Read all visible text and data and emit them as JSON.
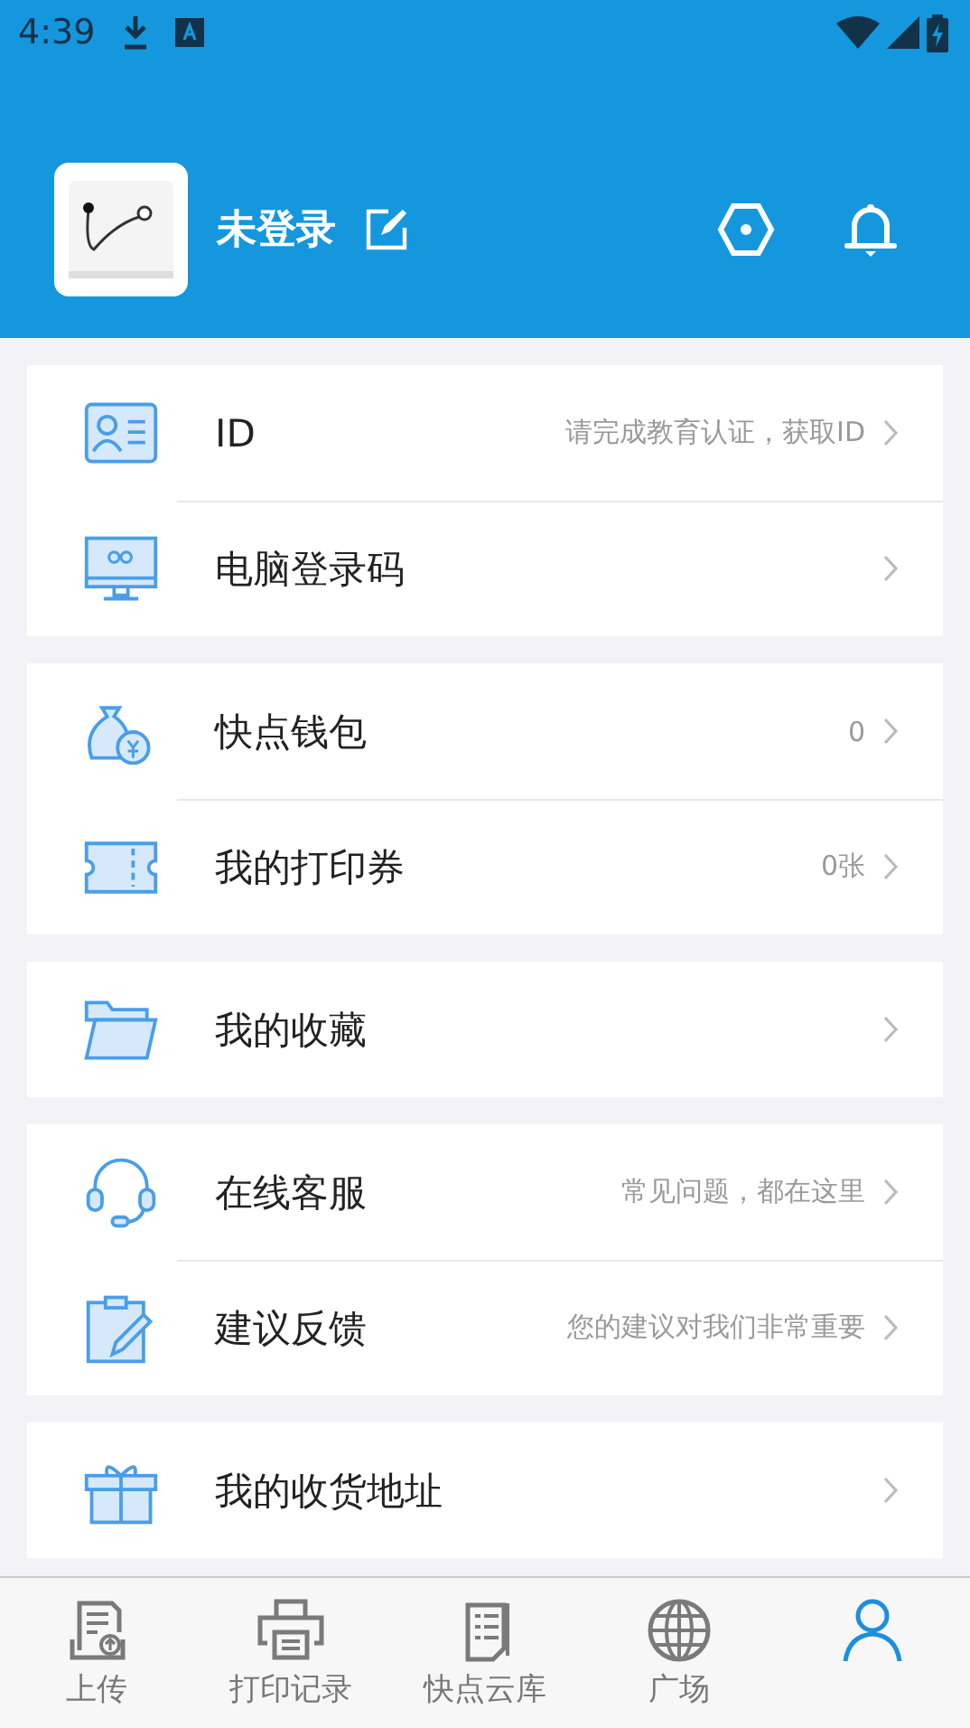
{
  "status_bar": {
    "time": "4:39"
  },
  "profile": {
    "name": "未登录"
  },
  "groups": [
    {
      "rows": [
        {
          "label": "ID",
          "detail": "请完成教育认证，获取ID"
        },
        {
          "label": "电脑登录码"
        }
      ]
    },
    {
      "rows": [
        {
          "label": "快点钱包",
          "detail": "0"
        },
        {
          "label": "我的打印券",
          "detail": "0张"
        }
      ]
    },
    {
      "rows": [
        {
          "label": "我的收藏"
        }
      ]
    },
    {
      "rows": [
        {
          "label": "在线客服",
          "detail": "常见问题，都在这里"
        },
        {
          "label": "建议反馈",
          "detail": "您的建议对我们非常重要"
        }
      ]
    },
    {
      "rows": [
        {
          "label": "我的收货地址"
        }
      ]
    }
  ],
  "tabs": [
    {
      "label": "上传",
      "selected": false
    },
    {
      "label": "打印记录",
      "selected": false
    },
    {
      "label": "快点云库",
      "selected": false
    },
    {
      "label": "广场",
      "selected": false
    },
    {
      "selected": true
    }
  ]
}
